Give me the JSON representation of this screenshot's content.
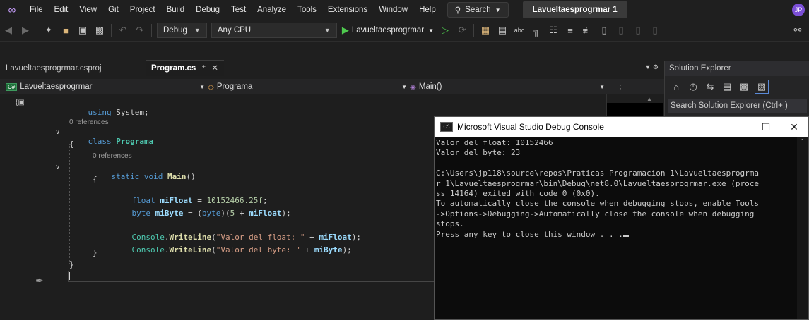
{
  "menu": {
    "items": [
      "File",
      "Edit",
      "View",
      "Git",
      "Project",
      "Build",
      "Debug",
      "Test",
      "Analyze",
      "Tools",
      "Extensions",
      "Window",
      "Help"
    ],
    "search_label": "Search",
    "solution_name": "Lavueltaesprogrmar 1",
    "avatar_initials": "JP"
  },
  "toolbar": {
    "config": "Debug",
    "platform": "Any CPU",
    "run_target": "Lavueltaesprogrmar"
  },
  "tabs": [
    {
      "label": "Lavueltaesprogrmar.csproj"
    },
    {
      "label": "Program.cs"
    }
  ],
  "navbar": {
    "project": "Lavueltaesprogrmar",
    "class": "Programa",
    "member": "Main()"
  },
  "code": {
    "l1_kw": "using",
    "l1_ns": "System;",
    "refs1": "0 references",
    "l2_kw": "class",
    "l2_name": "Programa",
    "brace_open": "{",
    "brace_close": "}",
    "refs2": "0 references",
    "l3_kw": "static void",
    "l3_name": "Main",
    "l3_rest": "()",
    "l4_kw": "float",
    "l4_var": "miFloat",
    "l4_eq": " = ",
    "l4_num": "10152466.25f",
    "l4_end": ";",
    "l5_kw": "byte",
    "l5_var": "miByte",
    "l5_eq": " = (",
    "l5_cast": "byte",
    "l5_mid": ")(",
    "l5_num": "5",
    "l5_plus": " + ",
    "l5_var2": "miFloat",
    "l5_end": ");",
    "l6_cls": "Console",
    "l6_dot": ".",
    "l6_fn": "WriteLine",
    "l6_open": "(",
    "l6_str": "\"Valor del float: \"",
    "l6_plus": " + ",
    "l6_var": "miFloat",
    "l6_end": ");",
    "l7_str": "\"Valor del byte: \"",
    "l7_var": "miByte"
  },
  "solution_explorer": {
    "title": "Solution Explorer",
    "search_placeholder": "Search Solution Explorer (Ctrl+;)"
  },
  "console": {
    "title": "Microsoft Visual Studio Debug Console",
    "lines": [
      "Valor del float: 10152466",
      "Valor del byte: 23",
      "",
      "C:\\Users\\jp118\\source\\repos\\Praticas Programacion 1\\Lavueltaesprogrma",
      "r 1\\Lavueltaesprogrmar\\bin\\Debug\\net8.0\\Lavueltaesprogrmar.exe (proce",
      "ss 14164) exited with code 0 (0x0).",
      "To automatically close the console when debugging stops, enable Tools",
      "->Options->Debugging->Automatically close the console when debugging",
      "stops.",
      "Press any key to close this window . . ."
    ]
  },
  "colors": {
    "accent": "#7b4fd6",
    "run_green": "#4ec94e"
  }
}
